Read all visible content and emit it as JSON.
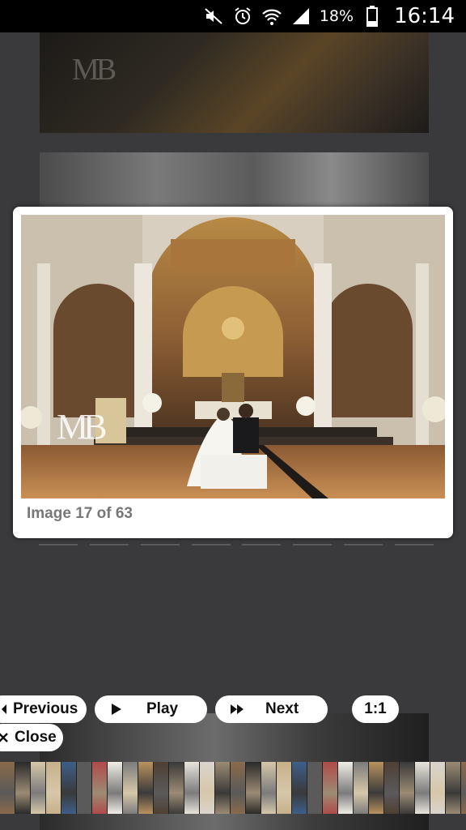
{
  "status_bar": {
    "battery_percent": "18%",
    "time": "16:14",
    "icons": [
      "mute-icon",
      "alarm-icon",
      "wifi-icon",
      "signal-icon",
      "battery-icon"
    ]
  },
  "background": {
    "watermark": "MB"
  },
  "lightbox": {
    "photo_watermark": "MB",
    "caption": "Image 17 of 63"
  },
  "controls": {
    "previous_label": "Previous",
    "play_label": "Play",
    "next_label": "Next",
    "actual_size_label": "1:1",
    "close_label": "Close"
  },
  "colors": {
    "overlay": "#3a3a3c",
    "caption": "#777777",
    "button_bg": "#ffffff"
  }
}
